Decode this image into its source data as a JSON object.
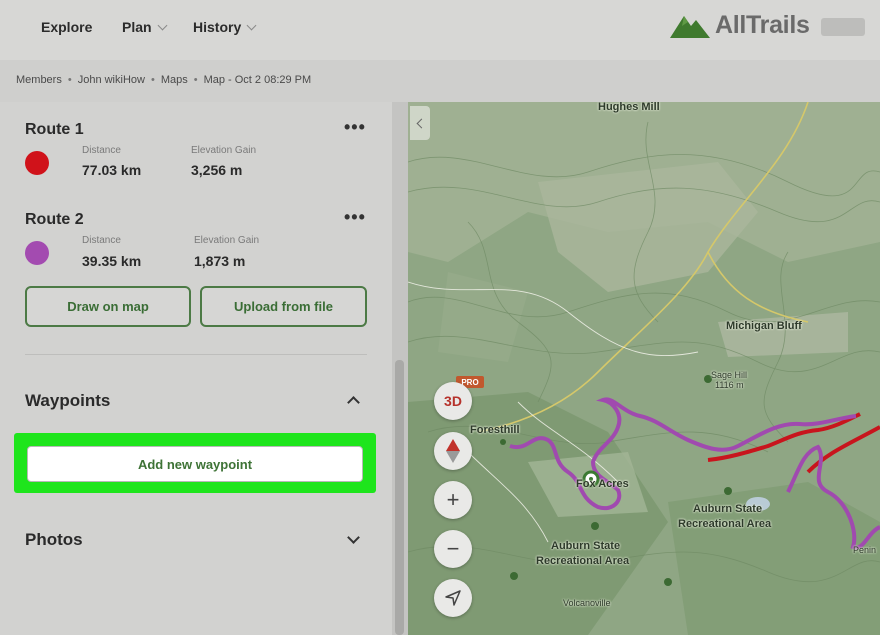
{
  "nav": {
    "items": [
      {
        "label": "Explore"
      },
      {
        "label": "Plan"
      },
      {
        "label": "History"
      }
    ],
    "brand": "AllTrails"
  },
  "breadcrumb": [
    "Members",
    "John wikiHow",
    "Maps",
    "Map - Oct 2 08:29 PM"
  ],
  "routes": [
    {
      "name": "Route 1",
      "color": "#d0121a",
      "distance_label": "Distance",
      "distance": "77.03 km",
      "elevation_label": "Elevation Gain",
      "elevation": "3,256 m"
    },
    {
      "name": "Route 2",
      "color": "#a34bb0",
      "distance_label": "Distance",
      "distance": "39.35 km",
      "elevation_label": "Elevation Gain",
      "elevation": "1,873 m"
    }
  ],
  "more_icon": "more-horizontal-icon",
  "buttons": {
    "draw": "Draw on map",
    "upload": "Upload from file",
    "add_waypoint": "Add new waypoint"
  },
  "sections": {
    "waypoints": "Waypoints",
    "photos": "Photos"
  },
  "map": {
    "labels": {
      "hughes_mill": "Hughes Mill",
      "michigan_bluff": "Michigan Bluff",
      "sage_hill": "Sage Hill",
      "sage_hill_elev": "1116 m",
      "foresthill": "Foresthill",
      "fox_acres": "Fox Acres",
      "auburn_sra_1a": "Auburn State",
      "auburn_sra_1b": "Recreational Area",
      "auburn_sra_2a": "Auburn State",
      "auburn_sra_2b": "Recreational Area",
      "volcanoville": "Volcanoville",
      "peninsula": "Penin"
    },
    "controls": {
      "three_d": "3D",
      "pro": "PRO",
      "zoom_in": "+",
      "zoom_out": "−"
    },
    "colors": {
      "route1": "#c8151d",
      "route2": "#a04aaf"
    }
  }
}
